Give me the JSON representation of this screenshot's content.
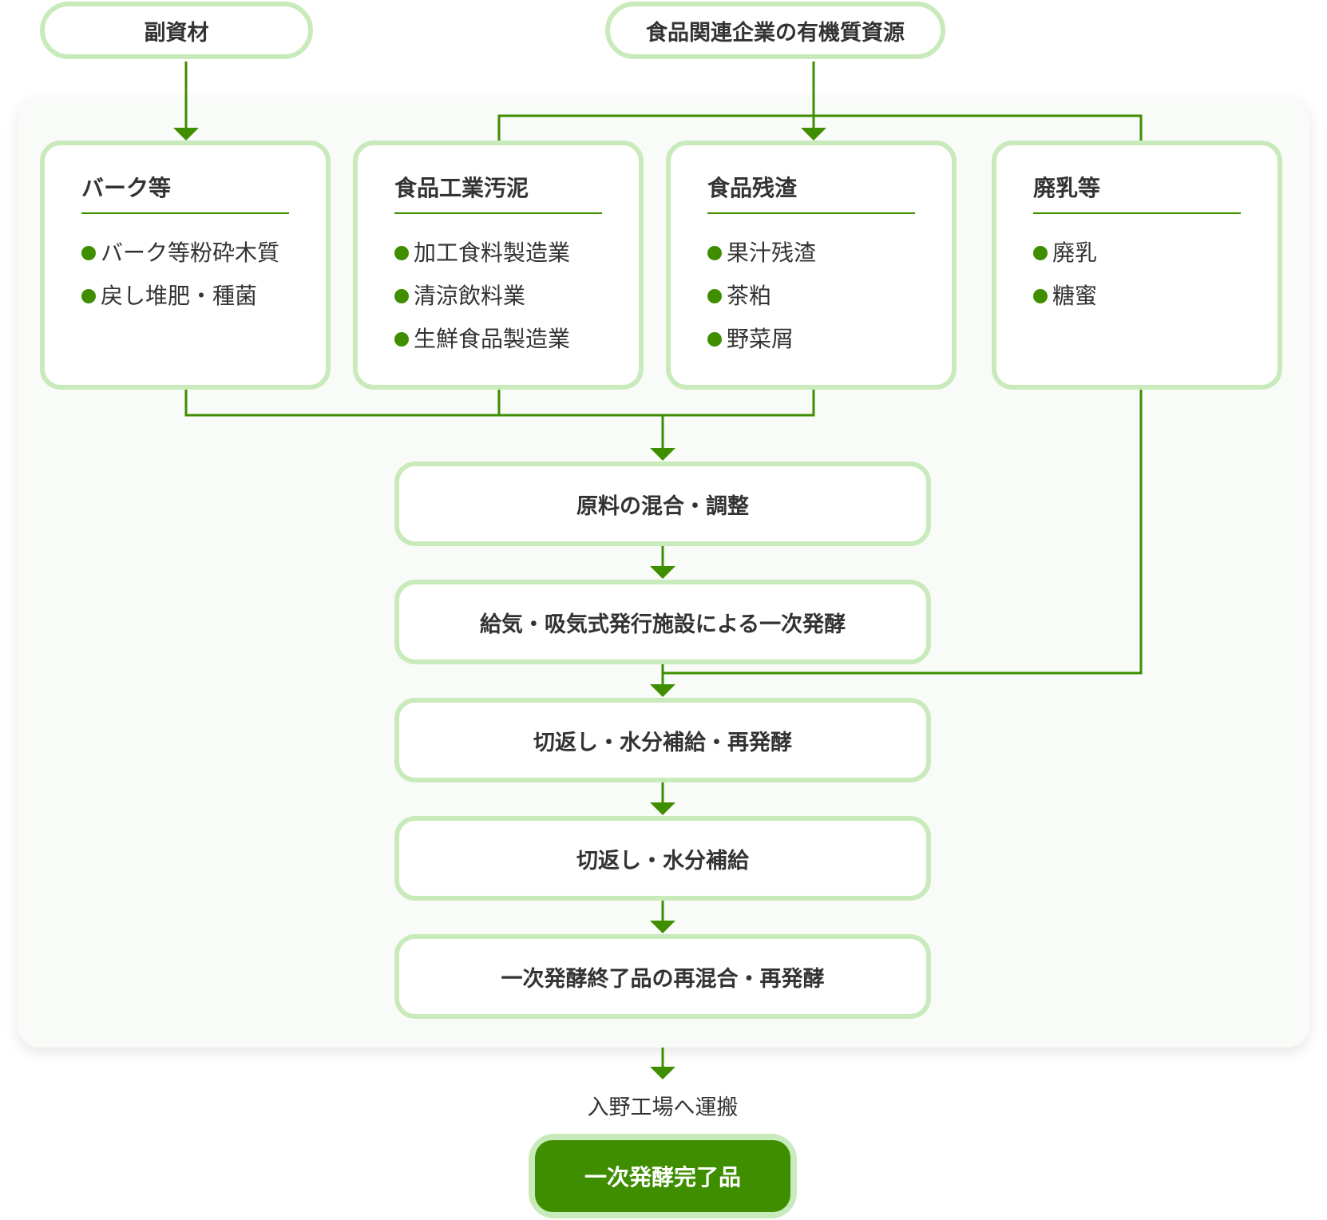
{
  "sources": {
    "subsidiary": "副資材",
    "food_organic": "食品関連企業の有機質資源"
  },
  "categories": [
    {
      "title": "バーク等",
      "items": [
        "バーク等粉砕木質",
        "戻し堆肥・種菌"
      ]
    },
    {
      "title": "食品工業汚泥",
      "items": [
        "加工食料製造業",
        "清涼飲料業",
        "生鮮食品製造業"
      ]
    },
    {
      "title": "食品残渣",
      "items": [
        "果汁残渣",
        "茶粕",
        "野菜屑"
      ]
    },
    {
      "title": "廃乳等",
      "items": [
        "廃乳",
        "糖蜜"
      ]
    }
  ],
  "steps": [
    "原料の混合・調整",
    "給気・吸気式発行施設による一次発酵",
    "切返し・水分補給・再発酵",
    "切返し・水分補給",
    "一次発酵終了品の再混合・再発酵"
  ],
  "transport_label": "入野工場へ運搬",
  "final_product": "一次発酵完了品",
  "colors": {
    "accent_green": "#3e8e00",
    "border_light_green": "#c9eabb",
    "panel_bg": "#f9fbf8",
    "text": "#333333"
  }
}
